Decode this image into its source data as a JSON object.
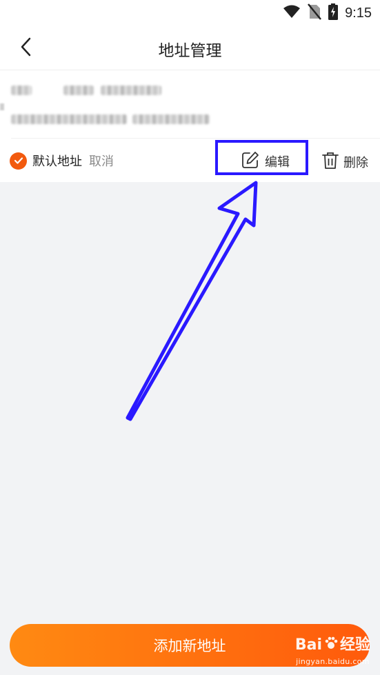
{
  "status_bar": {
    "time": "9:15",
    "icons": [
      "wifi-icon",
      "no-sim-icon",
      "battery-charging-icon"
    ]
  },
  "header": {
    "title": "地址管理",
    "back_icon": "chevron-left-icon"
  },
  "address": {
    "name_blurred": true,
    "address_blurred": true
  },
  "actions": {
    "default_label": "默认地址",
    "cancel_label": "取消",
    "edit_label": "编辑",
    "delete_label": "删除"
  },
  "annotation": {
    "box_color": "#2a19ff",
    "arrow_color": "#2a19ff"
  },
  "footer": {
    "add_button_label": "添加新地址",
    "accent_start": "#ff8a12",
    "accent_end": "#ff5a0c"
  },
  "watermark": {
    "brand": "Bai 经验",
    "brand_prefix": "Bai",
    "brand_suffix": "经验",
    "site": "jingyan.baidu.com"
  }
}
